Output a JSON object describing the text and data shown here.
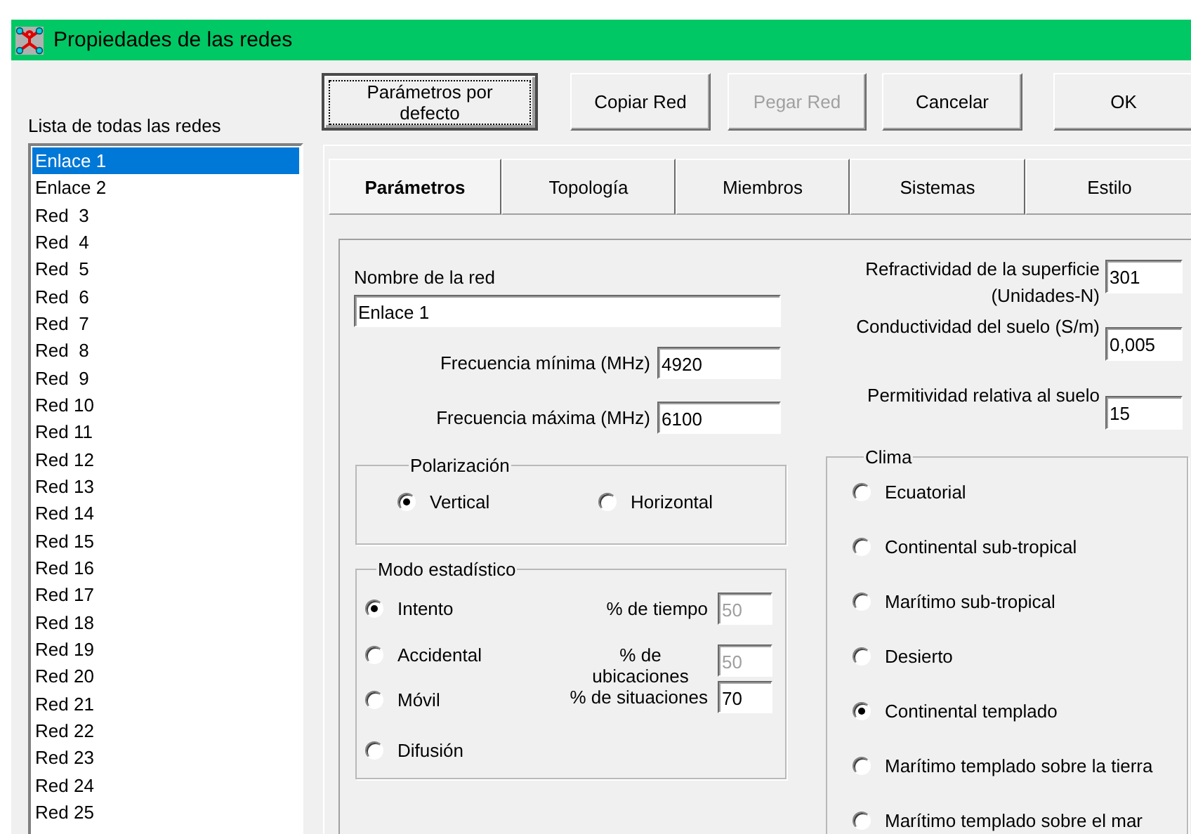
{
  "window": {
    "title": "Propiedades de las redes"
  },
  "network_list": {
    "label": "Lista de todas las redes",
    "items": [
      {
        "label": "Enlace 1",
        "selected": true
      },
      {
        "label": "Enlace 2",
        "selected": false
      },
      {
        "label": "Red  3",
        "selected": false
      },
      {
        "label": "Red  4",
        "selected": false
      },
      {
        "label": "Red  5",
        "selected": false
      },
      {
        "label": "Red  6",
        "selected": false
      },
      {
        "label": "Red  7",
        "selected": false
      },
      {
        "label": "Red  8",
        "selected": false
      },
      {
        "label": "Red  9",
        "selected": false
      },
      {
        "label": "Red 10",
        "selected": false
      },
      {
        "label": "Red 11",
        "selected": false
      },
      {
        "label": "Red 12",
        "selected": false
      },
      {
        "label": "Red 13",
        "selected": false
      },
      {
        "label": "Red 14",
        "selected": false
      },
      {
        "label": "Red 15",
        "selected": false
      },
      {
        "label": "Red 16",
        "selected": false
      },
      {
        "label": "Red 17",
        "selected": false
      },
      {
        "label": "Red 18",
        "selected": false
      },
      {
        "label": "Red 19",
        "selected": false
      },
      {
        "label": "Red 20",
        "selected": false
      },
      {
        "label": "Red 21",
        "selected": false
      },
      {
        "label": "Red 22",
        "selected": false
      },
      {
        "label": "Red 23",
        "selected": false
      },
      {
        "label": "Red 24",
        "selected": false
      },
      {
        "label": "Red 25",
        "selected": false
      }
    ]
  },
  "buttons": [
    {
      "label": "Parámetros por defecto",
      "default": true,
      "disabled": false
    },
    {
      "label": "Copiar Red",
      "default": false,
      "disabled": false
    },
    {
      "label": "Pegar Red",
      "default": false,
      "disabled": true
    },
    {
      "label": "Cancelar",
      "default": false,
      "disabled": false
    },
    {
      "label": "OK",
      "default": false,
      "disabled": false
    }
  ],
  "tabs": [
    {
      "label": "Parámetros",
      "selected": true
    },
    {
      "label": "Topología",
      "selected": false
    },
    {
      "label": "Miembros",
      "selected": false
    },
    {
      "label": "Sistemas",
      "selected": false
    },
    {
      "label": "Estilo",
      "selected": false
    }
  ],
  "parameters": {
    "network_name": {
      "label": "Nombre de la red",
      "value": "Enlace 1"
    },
    "min_frequency": {
      "label": "Frecuencia mínima (MHz)",
      "value": "4920"
    },
    "max_frequency": {
      "label": "Frecuencia máxima (MHz)",
      "value": "6100"
    },
    "polarization": {
      "title": "Polarización",
      "options": [
        {
          "label": "Vertical",
          "selected": true
        },
        {
          "label": "Horizontal",
          "selected": false
        }
      ]
    },
    "statistical_mode": {
      "title": "Modo estadístico",
      "options": [
        {
          "label": "Intento",
          "selected": true
        },
        {
          "label": "Accidental",
          "selected": false
        },
        {
          "label": "Móvil",
          "selected": false
        },
        {
          "label": "Difusión",
          "selected": false
        }
      ],
      "fields": [
        {
          "label": "% de tiempo",
          "value": "50",
          "disabled": true
        },
        {
          "label": "% de ubicaciones",
          "value": "50",
          "disabled": true
        },
        {
          "label": "% de situaciones",
          "value": "70",
          "disabled": false
        }
      ]
    },
    "surface_refractivity": {
      "label": "Refractividad de la superficie (Unidades-N)",
      "value": "301"
    },
    "ground_conductivity": {
      "label": "Conductividad del suelo (S/m)",
      "value": "0,005"
    },
    "ground_permittivity": {
      "label": "Permitividad relativa al suelo",
      "value": "15"
    },
    "climate": {
      "title": "Clima",
      "options": [
        {
          "label": "Ecuatorial",
          "selected": false
        },
        {
          "label": "Continental sub-tropical",
          "selected": false
        },
        {
          "label": "Marítimo sub-tropical",
          "selected": false
        },
        {
          "label": "Desierto",
          "selected": false
        },
        {
          "label": "Continental templado",
          "selected": true
        },
        {
          "label": "Marítimo templado sobre la tierra",
          "selected": false
        },
        {
          "label": "Marítimo templado sobre el mar",
          "selected": false
        }
      ]
    }
  }
}
